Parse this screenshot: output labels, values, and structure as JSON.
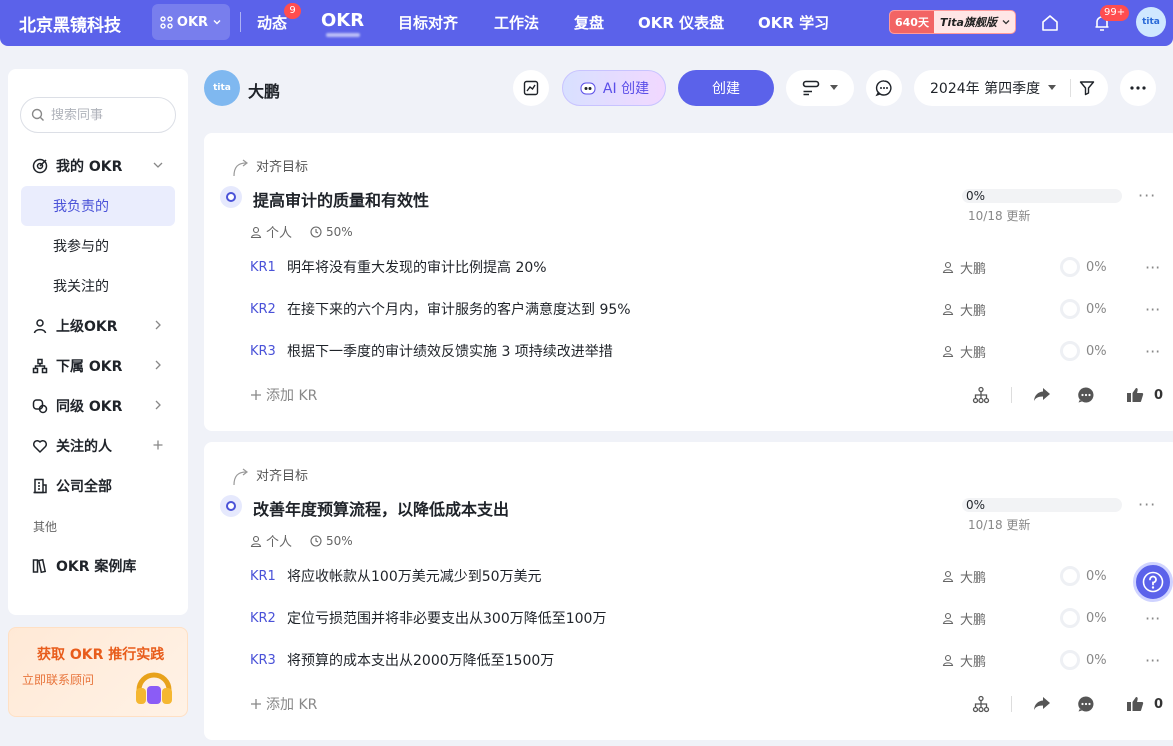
{
  "topbar": {
    "brand": "北京黑镜科技",
    "app_switch": "OKR",
    "nav": [
      {
        "label": "动态",
        "badge": "9"
      },
      {
        "label": "OKR"
      },
      {
        "label": "目标对齐"
      },
      {
        "label": "工作法"
      },
      {
        "label": "复盘"
      },
      {
        "label": "OKR 仪表盘"
      },
      {
        "label": "OKR 学习"
      }
    ],
    "tita_days": "640天",
    "tita_plan": "Tita旗舰版",
    "notification_count": "99+",
    "avatar_text": "tita"
  },
  "sidebar": {
    "search_placeholder": "搜索同事",
    "my_okr": "我的 OKR",
    "sub_items": [
      "我负责的",
      "我参与的",
      "我关注的"
    ],
    "items": [
      "上级OKR",
      "下属 OKR",
      "同级 OKR",
      "关注的人",
      "公司全部"
    ],
    "group_other": "其他",
    "case_library": "OKR 案例库",
    "promo_title": "获取 OKR 推行实践",
    "promo_sub": "立即联系顾问"
  },
  "header": {
    "avatar_text": "tita",
    "owner": "大鹏",
    "ai_create": "AI 创建",
    "create": "创建",
    "period": "2024年 第四季度"
  },
  "objectives": [
    {
      "align_label": "对齐目标",
      "title": "提高审计的质量和有效性",
      "scope": "个人",
      "weight": "50%",
      "progress": "0%",
      "progress_value": 0,
      "updated": "10/18 更新",
      "krs": [
        {
          "code": "KR1",
          "text": "明年将没有重大发现的审计比例提高 20%",
          "owner": "大鹏",
          "progress": "0%"
        },
        {
          "code": "KR2",
          "text": "在接下来的六个月内，审计服务的客户满意度达到 95%",
          "owner": "大鹏",
          "progress": "0%"
        },
        {
          "code": "KR3",
          "text": "根据下一季度的审计绩效反馈实施 3 项持续改进举措",
          "owner": "大鹏",
          "progress": "0%"
        }
      ],
      "add_kr": "添加 KR",
      "likes": "0"
    },
    {
      "align_label": "对齐目标",
      "title": "改善年度预算流程，以降低成本支出",
      "scope": "个人",
      "weight": "50%",
      "progress": "0%",
      "progress_value": 0,
      "updated": "10/18 更新",
      "krs": [
        {
          "code": "KR1",
          "text": "将应收帐款从100万美元减少到50万美元",
          "owner": "大鹏",
          "progress": "0%"
        },
        {
          "code": "KR2",
          "text": "定位亏损范围并将非必要支出从300万降低至100万",
          "owner": "大鹏",
          "progress": "0%"
        },
        {
          "code": "KR3",
          "text": "将预算的成本支出从2000万降低至1500万",
          "owner": "大鹏",
          "progress": "0%"
        }
      ],
      "add_kr": "添加 KR",
      "likes": "0"
    }
  ],
  "colors": {
    "primary": "#5b62ea",
    "badge": "#ff4d4f",
    "active_bg": "#eaedfd",
    "promo": "#e85c1b"
  }
}
